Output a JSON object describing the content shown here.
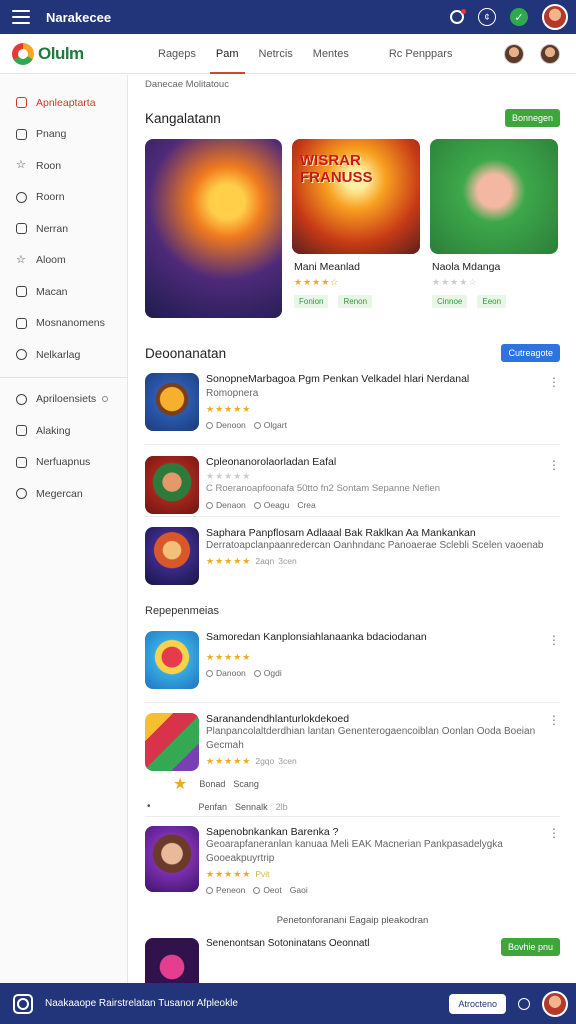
{
  "app": {
    "title": "Narakecee"
  },
  "topbar": {
    "icons": [
      "search-icon",
      "clock-icon",
      "notification-icon",
      "profile-avatar"
    ],
    "bell_glyph": "¢",
    "badge_glyph": "✓"
  },
  "logo": {
    "text": "Olulm"
  },
  "nav": {
    "tabs": [
      "Rageps",
      "Pam",
      "Netrcis",
      "Mentes",
      "Rc Penppars"
    ]
  },
  "sidebar": {
    "items": [
      {
        "label": "Apnleaptarta",
        "icon": "calendar-icon",
        "active": true
      },
      {
        "label": "Pnang",
        "icon": "mail-icon"
      },
      {
        "label": "Roon",
        "icon": "star-icon"
      },
      {
        "label": "Roorn",
        "icon": "circle-icon"
      },
      {
        "label": "Nerran",
        "icon": "grid-icon"
      },
      {
        "label": "Aloom",
        "icon": "star-outline-icon"
      },
      {
        "label": "Macan",
        "icon": "puzzle-icon"
      },
      {
        "label": "Mosnanomens",
        "icon": "box-icon"
      },
      {
        "label": "Nelkarlag",
        "icon": "tag-icon"
      }
    ],
    "items2": [
      {
        "label": "Apriloensiets",
        "icon": "settings-icon"
      },
      {
        "label": "Alaking",
        "icon": "box-icon"
      },
      {
        "label": "Nerfuapnus",
        "icon": "box-icon"
      },
      {
        "label": "Megercan",
        "icon": "chat-icon"
      }
    ]
  },
  "main": {
    "breadcrumb": "Danecae Molitatouc",
    "featured": {
      "title": "Kangalatann",
      "button": "Bonnegen",
      "cards": [
        {
          "name": "",
          "banner": ""
        },
        {
          "name": "Mani Meanlad",
          "banner": "WISRAR\nFRANUSS",
          "stars": "★★★★☆",
          "tags": [
            "Fonion",
            "Renon"
          ]
        },
        {
          "name": "Naola Mdanga",
          "banner": "",
          "stars": "★★★★☆",
          "tags": [
            "Cinnoe",
            "Eeon"
          ]
        }
      ]
    },
    "section2": {
      "title": "Deoonanatan",
      "button": "Cutreagote"
    },
    "list1": [
      {
        "title": "SonopneMarbagoa Pgm Penkan Velkadel hlari Nerdanal",
        "sub": "Romopnera",
        "stars": "★★★★★",
        "meta": [
          "Denoon",
          "Olgart"
        ]
      },
      {
        "title": "Cpleonanorolaorladan Eafal",
        "sub": "C  Roeranoapfoonafa 50tto fn2 Sontam Sepanne Nefien",
        "stars": "★★★★★",
        "meta": [
          "Denaon",
          "Oeagu",
          "Crea"
        ]
      },
      {
        "title": "Saphara Panpflosam Adlaaal Bak Raklkan Aa Mankankan",
        "sub": "Derratoapclanpaanredercan Oanhndanc Panoaerae Sclebli Scelen vaoenab",
        "stars": "★★★★★",
        "rating": "2aqn",
        "count": "3cen",
        "meta": []
      }
    ],
    "subsection": "Repepenmeias",
    "list2": [
      {
        "title": "Samoredan Kanplonsiahlanaanka bdaciodanan",
        "sub": "",
        "stars": "★★★★★",
        "meta": [
          "Danoon",
          "Ogdi"
        ]
      },
      {
        "title": "Saranandendhlanturlokdekoed",
        "sub": "Planpancolaltderdhian lantan Genenterogaencoiblan Oonlan Ooda Boeian Gecmah",
        "stars": "★★★★★",
        "rating": "2gqo",
        "count": "3cen",
        "meta": []
      }
    ],
    "inline_row": {
      "label1": "Bonad",
      "label2": "Scang",
      "label3": "Penfan",
      "label4": "Sennalk",
      "label5": "2lb"
    },
    "list3": [
      {
        "title": "Sapenobnkankan Barenka ?",
        "sub": "Geoarapfaneranlan kanuaa Meli EAK Macnerian Pankpasadelygka Gooeakpuyrtrip",
        "stars": "★★★★★",
        "rating": "Pvit",
        "meta": [
          "Peneon",
          "Oeot",
          "Gaoi"
        ]
      }
    ],
    "footnote": "Penetonforanani Eagaip pleakodran",
    "last_item": {
      "title": "Senenontsan Sotoninatans Oeonnatl",
      "button": "Bovhie pnu"
    }
  },
  "bottombar": {
    "text": "Naakaaope Rairstrelatan Tusanor Afpleokle",
    "pill": "Atrocteno"
  }
}
